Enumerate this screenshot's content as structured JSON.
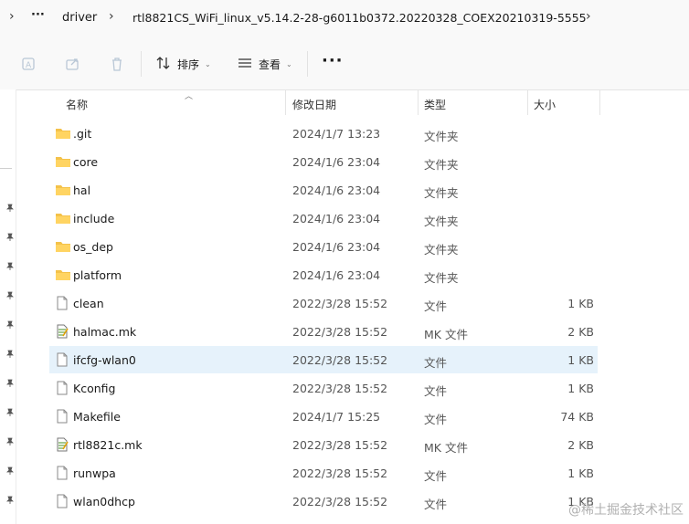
{
  "breadcrumb": {
    "overflow_label": "···",
    "items": [
      "driver",
      "rtl8821CS_WiFi_linux_v5.14.2-28-g6011b0372.20220328_COEX20210319-5555"
    ]
  },
  "toolbar": {
    "sort_label": "排序",
    "view_label": "查看",
    "more_label": "···"
  },
  "columns": {
    "name": "名称",
    "date": "修改日期",
    "type": "类型",
    "size": "大小"
  },
  "files": [
    {
      "name": ".git",
      "date": "2024/1/7 13:23",
      "type": "文件夹",
      "size": "",
      "icon": "folder-icon"
    },
    {
      "name": "core",
      "date": "2024/1/6 23:04",
      "type": "文件夹",
      "size": "",
      "icon": "folder-icon"
    },
    {
      "name": "hal",
      "date": "2024/1/6 23:04",
      "type": "文件夹",
      "size": "",
      "icon": "folder-icon"
    },
    {
      "name": "include",
      "date": "2024/1/6 23:04",
      "type": "文件夹",
      "size": "",
      "icon": "folder-icon"
    },
    {
      "name": "os_dep",
      "date": "2024/1/6 23:04",
      "type": "文件夹",
      "size": "",
      "icon": "folder-icon"
    },
    {
      "name": "platform",
      "date": "2024/1/6 23:04",
      "type": "文件夹",
      "size": "",
      "icon": "folder-icon"
    },
    {
      "name": "clean",
      "date": "2022/3/28 15:52",
      "type": "文件",
      "size": "1 KB",
      "icon": "file-icon"
    },
    {
      "name": "halmac.mk",
      "date": "2022/3/28 15:52",
      "type": "MK 文件",
      "size": "2 KB",
      "icon": "mk-file-icon"
    },
    {
      "name": "ifcfg-wlan0",
      "date": "2022/3/28 15:52",
      "type": "文件",
      "size": "1 KB",
      "icon": "file-icon",
      "selected": true
    },
    {
      "name": "Kconfig",
      "date": "2022/3/28 15:52",
      "type": "文件",
      "size": "1 KB",
      "icon": "file-icon"
    },
    {
      "name": "Makefile",
      "date": "2024/1/7 15:25",
      "type": "文件",
      "size": "74 KB",
      "icon": "file-icon"
    },
    {
      "name": "rtl8821c.mk",
      "date": "2022/3/28 15:52",
      "type": "MK 文件",
      "size": "2 KB",
      "icon": "mk-file-icon"
    },
    {
      "name": "runwpa",
      "date": "2022/3/28 15:52",
      "type": "文件",
      "size": "1 KB",
      "icon": "file-icon"
    },
    {
      "name": "wlan0dhcp",
      "date": "2022/3/28 15:52",
      "type": "文件",
      "size": "1 KB",
      "icon": "file-icon"
    }
  ],
  "watermark": "@稀土掘金技术社区",
  "colors": {
    "folder": "#f4c24a",
    "selection": "#e6f2fb",
    "mk_accent": "#6aa84f"
  }
}
